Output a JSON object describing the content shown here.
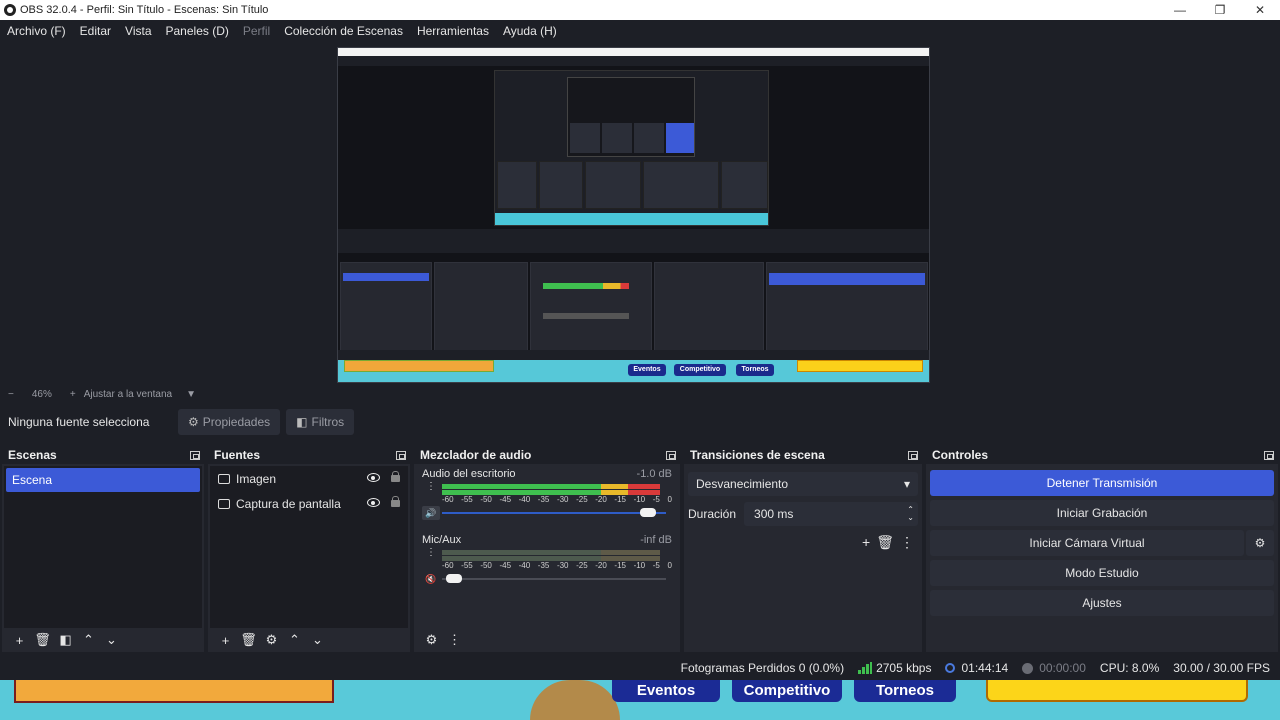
{
  "window": {
    "title": "OBS 32.0.4 - Perfil: Sin Título - Escenas: Sin Título",
    "minimize": "—",
    "maximize": "❐",
    "close": "✕"
  },
  "menu": [
    "Archivo (F)",
    "Editar",
    "Vista",
    "Paneles (D)",
    "Perfil",
    "Colección de Escenas",
    "Herramientas",
    "Ayuda (H)"
  ],
  "zoom": {
    "minus": "−",
    "level": "46%",
    "plus": "+",
    "fit": "Ajustar a la ventana",
    "dropdown": "▼"
  },
  "source_toolbar": {
    "no_source": "Ninguna fuente selecciona",
    "properties": "Propiedades",
    "filters": "Filtros"
  },
  "docks": {
    "scenes": {
      "title": "Escenas",
      "items": [
        "Escena"
      ]
    },
    "sources": {
      "title": "Fuentes",
      "items": [
        "Imagen",
        "Captura de pantalla"
      ]
    },
    "mixer": {
      "title": "Mezclador de audio",
      "tracks": [
        {
          "name": "Audio del escritorio",
          "db": "-1.0 dB",
          "muted": false,
          "volume": 0.95
        },
        {
          "name": "Mic/Aux",
          "db": "-inf dB",
          "muted": true,
          "volume": 0.02
        }
      ],
      "ticks": [
        "-60",
        "-55",
        "-50",
        "-45",
        "-40",
        "-35",
        "-30",
        "-25",
        "-20",
        "-15",
        "-10",
        "-5",
        "0"
      ]
    },
    "transitions": {
      "title": "Transiciones de escena",
      "selected": "Desvanecimiento",
      "duration_label": "Duración",
      "duration_value": "300 ms"
    },
    "controls": {
      "title": "Controles",
      "stop_stream": "Detener Transmisión",
      "start_recording": "Iniciar Grabación",
      "start_virtualcam": "Iniciar Cámara Virtual",
      "studio_mode": "Modo Estudio",
      "settings": "Ajustes"
    }
  },
  "status": {
    "dropped_frames": "Fotogramas Perdidos 0 (0.0%)",
    "bitrate": "2705 kbps",
    "live_time": "01:44:14",
    "rec_time": "00:00:00",
    "cpu": "CPU: 8.0%",
    "fps": "30.00 / 30.00 FPS"
  },
  "banner": {
    "tabs": [
      "Eventos",
      "Competitivo",
      "Torneos"
    ]
  },
  "colors": {
    "accent": "#3c5ad7",
    "background": "#1d1f26",
    "meter_green": "#3fbf4f",
    "meter_yellow": "#e8b92a",
    "meter_red": "#d93a3a"
  }
}
